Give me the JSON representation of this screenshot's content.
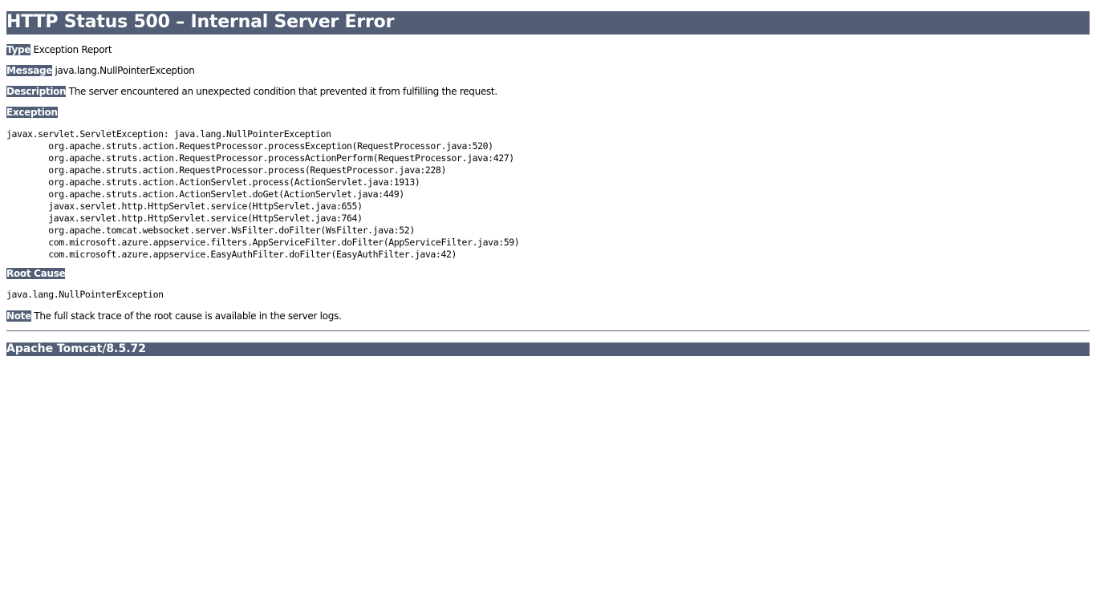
{
  "header": {
    "title": "HTTP Status 500 – Internal Server Error"
  },
  "type": {
    "label": "Type",
    "value": "Exception Report"
  },
  "message": {
    "label": "Message",
    "value": "java.lang.NullPointerException"
  },
  "description": {
    "label": "Description",
    "value": "The server encountered an unexpected condition that prevented it from fulfilling the request."
  },
  "exception": {
    "label": "Exception",
    "trace": [
      "javax.servlet.ServletException: java.lang.NullPointerException",
      "\torg.apache.struts.action.RequestProcessor.processException(RequestProcessor.java:520)",
      "\torg.apache.struts.action.RequestProcessor.processActionPerform(RequestProcessor.java:427)",
      "\torg.apache.struts.action.RequestProcessor.process(RequestProcessor.java:228)",
      "\torg.apache.struts.action.ActionServlet.process(ActionServlet.java:1913)",
      "\torg.apache.struts.action.ActionServlet.doGet(ActionServlet.java:449)",
      "\tjavax.servlet.http.HttpServlet.service(HttpServlet.java:655)",
      "\tjavax.servlet.http.HttpServlet.service(HttpServlet.java:764)",
      "\torg.apache.tomcat.websocket.server.WsFilter.doFilter(WsFilter.java:52)",
      "\tcom.microsoft.azure.appservice.filters.AppServiceFilter.doFilter(AppServiceFilter.java:59)",
      "\tcom.microsoft.azure.appservice.EasyAuthFilter.doFilter(EasyAuthFilter.java:42)"
    ]
  },
  "root_cause": {
    "label": "Root Cause",
    "trace": "java.lang.NullPointerException"
  },
  "note": {
    "label": "Note",
    "value": "The full stack trace of the root cause is available in the server logs."
  },
  "footer": {
    "server": "Apache Tomcat/8.5.72"
  },
  "colors": {
    "band": "#525d76",
    "band_text": "#ffffff"
  }
}
